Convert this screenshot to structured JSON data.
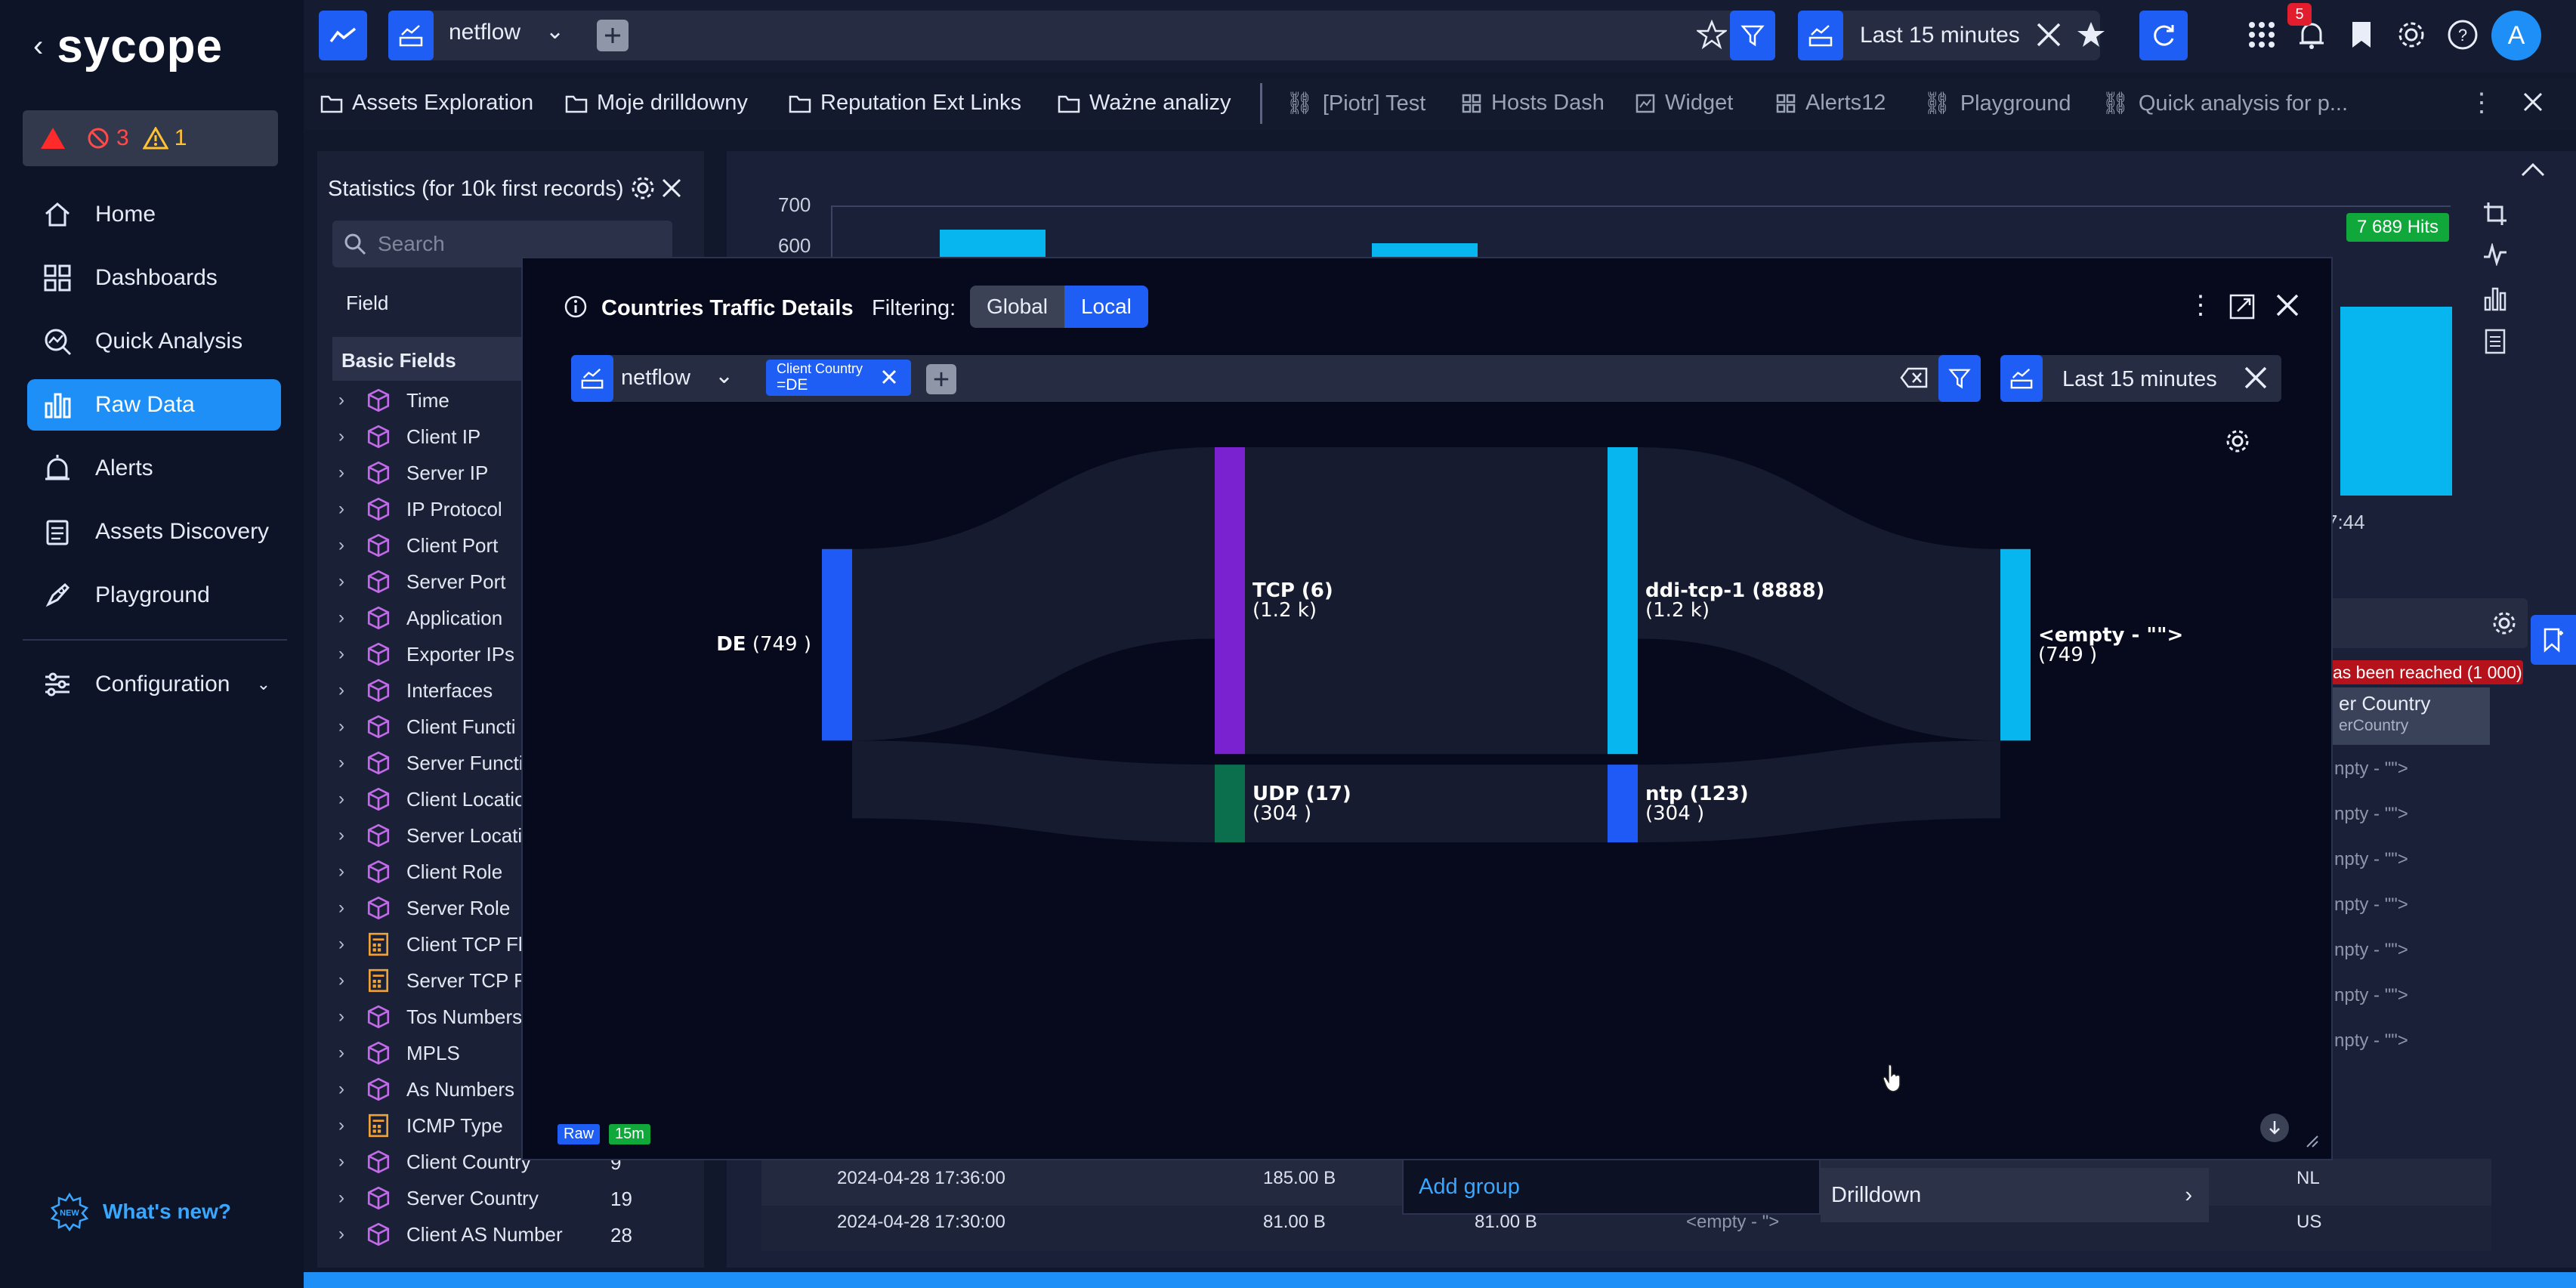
{
  "app": {
    "brand": "sycope",
    "brand_color": "#1e8ff7"
  },
  "alerts": {
    "critical_count": "",
    "blocked_count": "3",
    "warning_count": "1"
  },
  "sidebar": {
    "items": [
      {
        "label": "Home",
        "icon": "home-icon"
      },
      {
        "label": "Dashboards",
        "icon": "dashboards-icon"
      },
      {
        "label": "Quick Analysis",
        "icon": "quick-analysis-icon"
      },
      {
        "label": "Raw Data",
        "icon": "raw-data-icon",
        "active": true
      },
      {
        "label": "Alerts",
        "icon": "alerts-icon"
      },
      {
        "label": "Assets Discovery",
        "icon": "assets-discovery-icon"
      },
      {
        "label": "Playground",
        "icon": "playground-icon"
      }
    ],
    "configuration": "Configuration",
    "whats_new": "What's new?"
  },
  "topbar": {
    "source": "netflow",
    "time_range": "Last 15 minutes",
    "notification_count": "5",
    "avatar": "A"
  },
  "tabs": [
    {
      "label": "Assets Exploration",
      "icon": "folder-icon"
    },
    {
      "label": "Moje drilldowny",
      "icon": "folder-icon"
    },
    {
      "label": "Reputation Ext Links",
      "icon": "folder-icon"
    },
    {
      "label": "Ważne analizy",
      "icon": "folder-icon"
    },
    {
      "label": "[Piotr] Test",
      "icon": "link-icon"
    },
    {
      "label": "Hosts Dash",
      "icon": "dashboard-icon"
    },
    {
      "label": "Widget",
      "icon": "widget-icon"
    },
    {
      "label": "Alerts12",
      "icon": "dashboard-icon"
    },
    {
      "label": "Playground",
      "icon": "link-icon"
    },
    {
      "label": "Quick analysis for p...",
      "icon": "link-icon"
    }
  ],
  "stats_panel": {
    "title": "Statistics (for 10k first records)",
    "search_placeholder": "Search",
    "field_header": "Field",
    "section": "Basic Fields",
    "fields": [
      {
        "name": "Time",
        "type": "cube"
      },
      {
        "name": "Client IP",
        "type": "cube"
      },
      {
        "name": "Server IP",
        "type": "cube"
      },
      {
        "name": "IP Protocol",
        "type": "cube"
      },
      {
        "name": "Client Port",
        "type": "cube"
      },
      {
        "name": "Server Port",
        "type": "cube"
      },
      {
        "name": "Application",
        "type": "cube"
      },
      {
        "name": "Exporter IPs",
        "type": "cube"
      },
      {
        "name": "Interfaces",
        "type": "cube"
      },
      {
        "name": "Client Functi",
        "type": "cube"
      },
      {
        "name": "Server Functi",
        "type": "cube"
      },
      {
        "name": "Client Locatio",
        "type": "cube"
      },
      {
        "name": "Server Locati",
        "type": "cube"
      },
      {
        "name": "Client Role",
        "type": "cube"
      },
      {
        "name": "Server Role",
        "type": "cube"
      },
      {
        "name": "Client TCP Fl",
        "type": "calc"
      },
      {
        "name": "Server TCP F",
        "type": "calc"
      },
      {
        "name": "Tos Numbers",
        "type": "cube"
      },
      {
        "name": "MPLS",
        "type": "cube"
      },
      {
        "name": "As Numbers",
        "type": "cube"
      },
      {
        "name": "ICMP Type",
        "type": "calc"
      },
      {
        "name": "Client Country",
        "type": "cube",
        "count": "9"
      },
      {
        "name": "Server Country",
        "type": "cube",
        "count": "19"
      },
      {
        "name": "Client AS Number",
        "type": "cube",
        "count": "28"
      }
    ]
  },
  "background_chart": {
    "y_ticks": [
      "700",
      "600"
    ],
    "hits_badge": "7 689 Hits",
    "time_label": "7:44"
  },
  "background_table": {
    "limit_warning": "as been reached (1 000)",
    "column_header": "er Country",
    "column_sub": "erCountry",
    "empty_cells": [
      "npty - \"\">",
      "npty - \"\">",
      "npty - \"\">",
      "npty - \"\">",
      "npty - \"\">",
      "npty - \"\">",
      "npty - \"\">"
    ],
    "rows": [
      {
        "time": "2024-04-28 17:36:00",
        "bytes": "185.00 B",
        "country": "NL"
      },
      {
        "time": "2024-04-28 17:30:00",
        "bytes": "81.00 B",
        "bytes2": "81.00 B",
        "empty": "<empty - \">",
        "country": "US"
      }
    ],
    "add_group": "Add group",
    "drilldown": "Drilldown"
  },
  "modal": {
    "title": "Countries Traffic Details",
    "filtering_label": "Filtering:",
    "filter_global": "Global",
    "filter_local": "Local",
    "source": "netflow",
    "chip_title": "Client Country",
    "chip_value": "=DE",
    "time_range": "Last 15 minutes",
    "badge_raw": "Raw",
    "badge_15m": "15m"
  },
  "chart_data": {
    "type": "sankey",
    "nodes": [
      {
        "id": "DE",
        "label": "DE",
        "count": "(749 )",
        "column": 0,
        "value": 749,
        "color": "#1f5af7"
      },
      {
        "id": "TCP",
        "label": "TCP (6)",
        "count": "(1.2 k)",
        "column": 1,
        "value": 1200,
        "color": "#7a22d0"
      },
      {
        "id": "UDP",
        "label": "UDP (17)",
        "count": "(304 )",
        "column": 1,
        "value": 304,
        "color": "#0b6f4d"
      },
      {
        "id": "ddi",
        "label": "ddi-tcp-1 (8888)",
        "count": "(1.2 k)",
        "column": 2,
        "value": 1200,
        "color": "#08b6ef"
      },
      {
        "id": "ntp",
        "label": "ntp (123)",
        "count": "(304 )",
        "column": 2,
        "value": 304,
        "color": "#1f5af7"
      },
      {
        "id": "empty",
        "label": "<empty - \"\">",
        "count": "(749 )",
        "column": 3,
        "value": 749,
        "color": "#08b6ef"
      }
    ],
    "links": [
      {
        "source": "DE",
        "target": "TCP"
      },
      {
        "source": "DE",
        "target": "UDP"
      },
      {
        "source": "TCP",
        "target": "ddi"
      },
      {
        "source": "UDP",
        "target": "ntp"
      },
      {
        "source": "ddi",
        "target": "empty"
      },
      {
        "source": "ntp",
        "target": "empty"
      }
    ]
  }
}
